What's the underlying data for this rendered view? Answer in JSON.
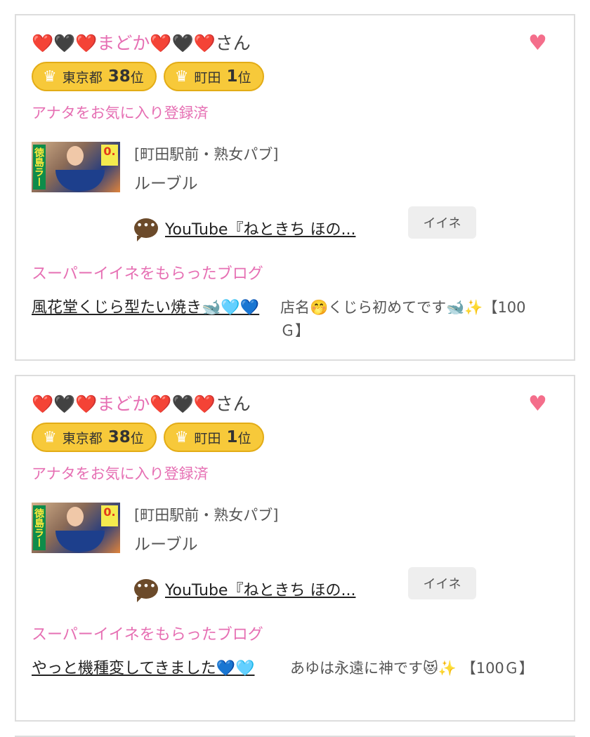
{
  "posts": [
    {
      "user": {
        "prefix": "❤️🖤❤️",
        "nickname": "まどか",
        "suffix": "❤️🖤❤️",
        "honorific": "さん"
      },
      "favorite_icon": "heart-icon",
      "badges": [
        {
          "icon": "crown-icon",
          "area": "東京都",
          "rank": "38",
          "unit": "位"
        },
        {
          "icon": "crown-icon",
          "area": "町田",
          "rank": "1",
          "unit": "位"
        }
      ],
      "fav_status": "アナタをお気に入り登録済",
      "shop": {
        "category": "[町田駅前・熟女パブ]",
        "name": "ルーブル",
        "thumb_text_left": "徳島ラーメン",
        "thumb_text_right": "0."
      },
      "comment_icon": "speech-bubble-icon",
      "comment_link": "YouTube『ねときち ほの...",
      "like_label": "イイネ",
      "super_label": "スーパーイイネをもらったブログ",
      "blog_title": "風花堂くじら型たい焼き🐋🩵💙",
      "blog_comment": "店名🤭くじら初めてです🐋✨【100Ｇ】"
    },
    {
      "user": {
        "prefix": "❤️🖤❤️",
        "nickname": "まどか",
        "suffix": "❤️🖤❤️",
        "honorific": "さん"
      },
      "favorite_icon": "heart-icon",
      "badges": [
        {
          "icon": "crown-icon",
          "area": "東京都",
          "rank": "38",
          "unit": "位"
        },
        {
          "icon": "crown-icon",
          "area": "町田",
          "rank": "1",
          "unit": "位"
        }
      ],
      "fav_status": "アナタをお気に入り登録済",
      "shop": {
        "category": "[町田駅前・熟女パブ]",
        "name": "ルーブル",
        "thumb_text_left": "徳島ラーメン",
        "thumb_text_right": "0."
      },
      "comment_icon": "speech-bubble-icon",
      "comment_link": "YouTube『ねときち ほの...",
      "like_label": "イイネ",
      "super_label": "スーパーイイネをもらったブログ",
      "blog_title": "やっと機種変してきました💙🩵",
      "blog_comment": "あゆは永遠に神です😻✨ 【100Ｇ】"
    }
  ],
  "colors": {
    "accent_pink": "#e66fb3",
    "badge_gold": "#f7c93a",
    "heart": "#f46e8b",
    "border": "#dddddd"
  }
}
